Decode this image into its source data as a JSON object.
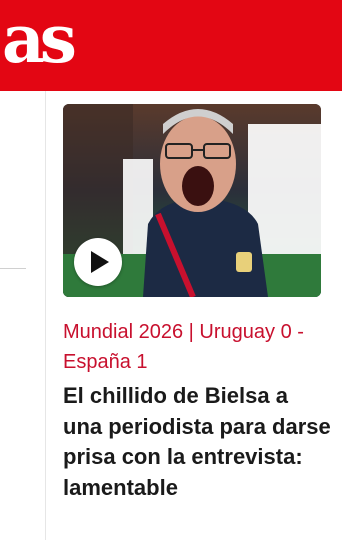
{
  "header": {
    "logo_text": "as",
    "background": "#e30613"
  },
  "article": {
    "thumbnail_alt": "Bielsa shouting in a post-match interview",
    "thumbnail_icon": "play-icon",
    "kicker_part1": "Mundial 2026",
    "kicker_separator": "|",
    "kicker_part2": "Uruguay 0 - España 1",
    "headline": "El chillido de Bielsa a una periodista para darse prisa con la entrevista: lamentable",
    "accent_color": "#c8102e"
  }
}
